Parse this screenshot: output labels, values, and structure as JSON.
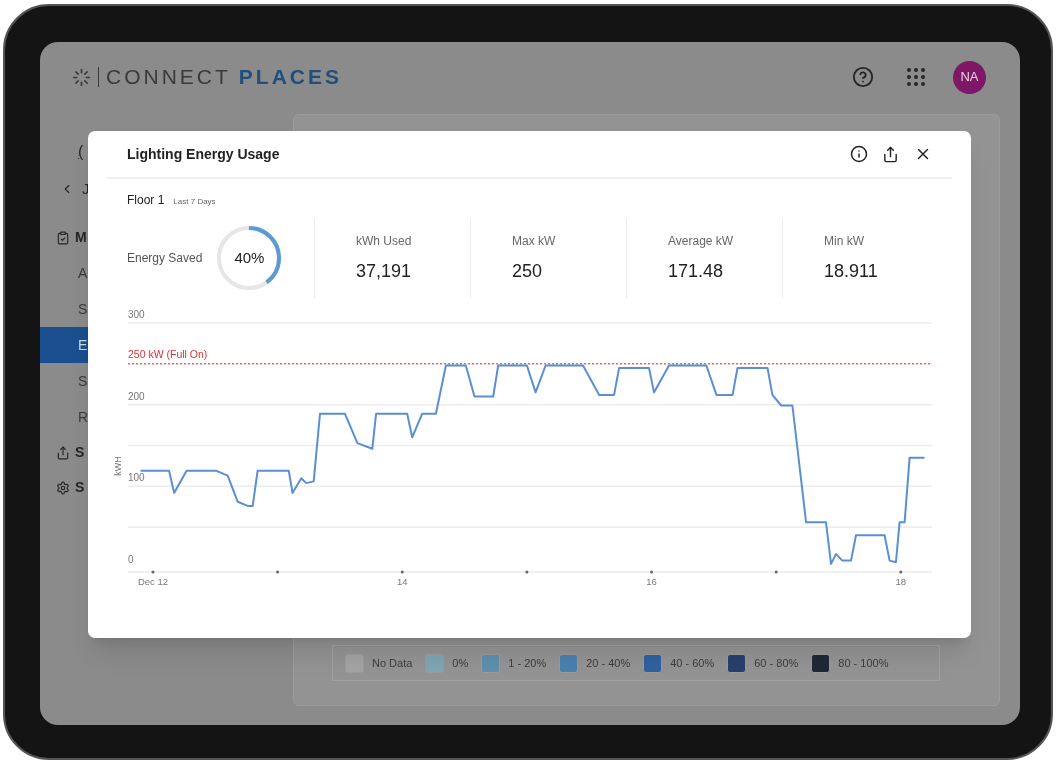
{
  "header": {
    "brand_first": "CONNECT",
    "brand_second": "PLACES",
    "avatar": "NA"
  },
  "sidebar": {
    "tab_fragment": "(",
    "back_label": "J",
    "items": [
      {
        "label": "M",
        "kind": "section",
        "selected": false
      },
      {
        "label": "A",
        "kind": "link",
        "selected": false
      },
      {
        "label": "S",
        "kind": "link",
        "selected": false
      },
      {
        "label": "E",
        "kind": "link",
        "selected": true
      },
      {
        "label": "S",
        "kind": "link",
        "selected": false
      },
      {
        "label": "R",
        "kind": "link",
        "selected": false
      },
      {
        "label": "S",
        "kind": "section",
        "selected": false
      },
      {
        "label": "S",
        "kind": "section",
        "selected": false
      }
    ]
  },
  "legend": [
    {
      "label": "No Data",
      "color": "#a3a3a3"
    },
    {
      "label": "0%",
      "color": "#7fa5b2"
    },
    {
      "label": "1 - 20%",
      "color": "#5f8eae"
    },
    {
      "label": "20 - 40%",
      "color": "#4a80ad"
    },
    {
      "label": "40 - 60%",
      "color": "#2f61a0"
    },
    {
      "label": "60 - 80%",
      "color": "#263f6e"
    },
    {
      "label": "80 - 100%",
      "color": "#1f2838"
    }
  ],
  "modal": {
    "title": "Lighting Energy Usage",
    "location": "Floor 1",
    "period": "Last 7 Days",
    "energy_saved": {
      "label": "Energy Saved",
      "value": "40%",
      "level": 0.4
    },
    "stats": [
      {
        "label": "kWh Used",
        "value": "37,191"
      },
      {
        "label": "Max kW",
        "value": "250"
      },
      {
        "label": "Average kW",
        "value": "171.48"
      },
      {
        "label": "Min kW",
        "value": "18.911"
      }
    ],
    "chart_data": {
      "type": "line",
      "ylabel": "kWH",
      "ylim": [
        0,
        300
      ],
      "yticks": [
        0,
        100,
        200,
        300
      ],
      "xlim": [
        11.8,
        18.25
      ],
      "xticks": [
        {
          "value": 12,
          "label": "Dec 12"
        },
        {
          "value": 14,
          "label": "14"
        },
        {
          "value": 16,
          "label": "16"
        },
        {
          "value": 18,
          "label": "18"
        }
      ],
      "x": [
        11.9,
        12.13,
        12.17,
        12.27,
        12.51,
        12.6,
        12.68,
        12.76,
        12.8,
        12.84,
        13.09,
        13.12,
        13.19,
        13.23,
        13.29,
        13.34,
        13.54,
        13.64,
        13.76,
        13.79,
        14.04,
        14.08,
        14.16,
        14.27,
        14.35,
        14.51,
        14.58,
        14.73,
        14.77,
        15.0,
        15.07,
        15.15,
        15.45,
        15.58,
        15.7,
        15.74,
        15.98,
        16.02,
        16.14,
        16.44,
        16.52,
        16.65,
        16.69,
        16.93,
        16.97,
        17.04,
        17.13,
        17.24,
        17.4,
        17.44,
        17.48,
        17.53,
        17.6,
        17.64,
        17.87,
        17.91,
        17.96,
        17.99,
        18.03,
        18.07,
        18.19
      ],
      "series": [
        {
          "color": "#5b8fd4",
          "values": [
            119,
            119,
            92,
            119,
            119,
            113,
            81,
            76,
            76,
            119,
            119,
            92,
            110,
            104,
            106,
            189,
            189,
            153,
            146,
            189,
            189,
            160,
            189,
            189,
            248,
            248,
            210,
            210,
            248,
            248,
            215,
            248,
            248,
            212,
            212,
            245,
            245,
            215,
            248,
            248,
            212,
            212,
            245,
            245,
            212,
            199,
            199,
            56,
            56,
            5,
            17,
            9,
            9,
            40,
            40,
            9,
            7,
            56,
            56,
            135,
            135
          ]
        }
      ],
      "ref_lines": [
        {
          "axis": "y",
          "value": 250,
          "label": "250 kW (Full On)",
          "color": "#d9343a"
        }
      ]
    }
  }
}
